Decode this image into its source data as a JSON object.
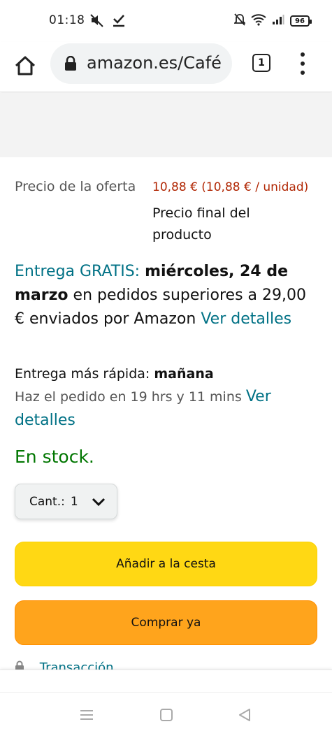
{
  "status_bar": {
    "time": "01:18",
    "battery": "96",
    "icons": [
      "mute-icon",
      "download-done-icon",
      "bell-off-icon",
      "wifi-icon",
      "signal-icon",
      "battery-icon"
    ]
  },
  "browser": {
    "url": "amazon.es/Café",
    "tab_count": "1",
    "icons": [
      "home-icon",
      "lock-icon",
      "menu-dots-icon"
    ]
  },
  "product": {
    "price_label": "Precio de la oferta",
    "price_value": "10,88 € (10,88 € / unidad)",
    "price_note": "Precio final del producto",
    "delivery": {
      "prefix": "Entrega GRATIS:",
      "date": "miércoles, 24 de marzo",
      "text": "en pedidos superiores a 29,00 € enviados por Amazon",
      "link": "Ver detalles"
    },
    "fast_delivery": {
      "label": "Entrega más rápida:",
      "when": "mañana"
    },
    "order_by": {
      "text": "Haz el pedido en 19 hrs y 11 mins",
      "link": "Ver detalles"
    },
    "stock": "En stock.",
    "quantity": {
      "label": "Cant.:",
      "value": "1"
    },
    "add_to_cart": "Añadir a la cesta",
    "buy_now": "Comprar ya",
    "partial_text": "Transacción"
  },
  "colors": {
    "price": "#b12704",
    "link": "#007185",
    "stock": "#007600",
    "cart_button": "#ffd814",
    "buy_button": "#ffa41c"
  }
}
